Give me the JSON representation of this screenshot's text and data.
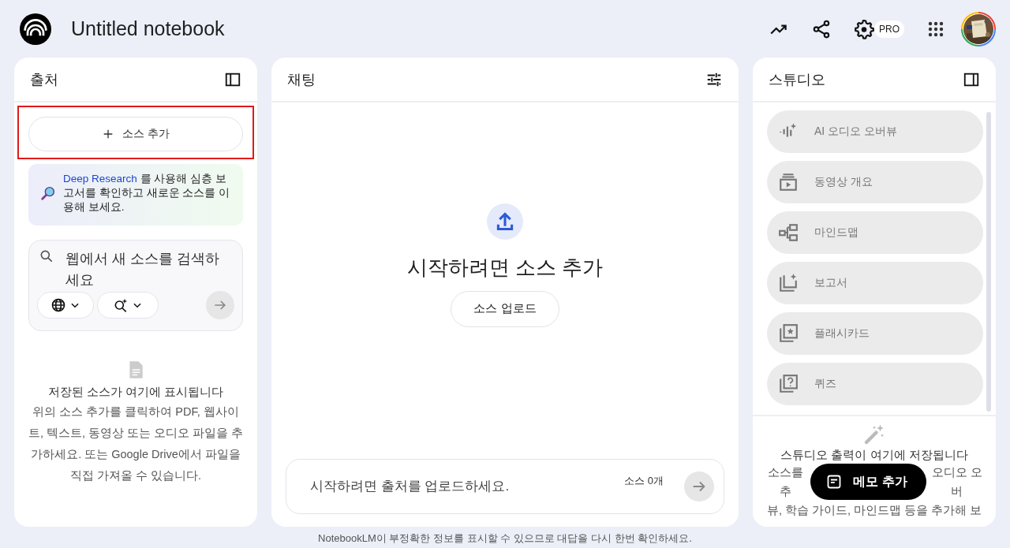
{
  "header": {
    "title": "Untitled notebook",
    "badge": "PRO"
  },
  "sources": {
    "title": "출처",
    "add_source": {
      "label": "소스 추가",
      "highlighted": true
    },
    "promo": {
      "link": "Deep Research",
      "rest": "를 사용해 심층 보고서를 확인하고 새로운 소스를 이용해 보세요."
    },
    "search": {
      "placeholder": "웹에서 새 소스를 검색하세요",
      "submit_disabled": true
    },
    "empty": {
      "title": "저장된 소스가 여기에 표시됩니다",
      "text": "위의 소스 추가를 클릭하여 PDF, 웹사이트, 텍스트, 동영상 또는 오디오 파일을 추가하세요. 또는 Google Drive에서 파일을 직접 가져올 수 있습니다."
    }
  },
  "chat": {
    "title": "채팅",
    "heading": "시작하려면 소스 추가",
    "upload_button": "소스 업로드",
    "input": {
      "placeholder": "시작하려면 출처를 업로드하세요.",
      "count": "소스 0개",
      "submit_disabled": true
    }
  },
  "studio": {
    "title": "스튜디오",
    "items": [
      {
        "label": "AI 오디오 오버뷰",
        "disabled": true
      },
      {
        "label": "동영상 개요",
        "disabled": true
      },
      {
        "label": "마인드맵",
        "disabled": true
      },
      {
        "label": "보고서",
        "disabled": true
      },
      {
        "label": "플래시카드",
        "disabled": true
      },
      {
        "label": "퀴즈",
        "disabled": true
      }
    ],
    "empty": {
      "title": "스튜디오 출력이 여기에 저장됩니다",
      "text_left": "소스를 추",
      "text_right": "오디오 오버",
      "text_last": "뷰, 학습 가이드, 마인드맵 등을 추가해 보"
    },
    "note_button": "메모 추가"
  },
  "footer": "NotebookLM이 부정확한 정보를 표시할 수 있으므로 대답을 다시 한번 확인하세요."
}
